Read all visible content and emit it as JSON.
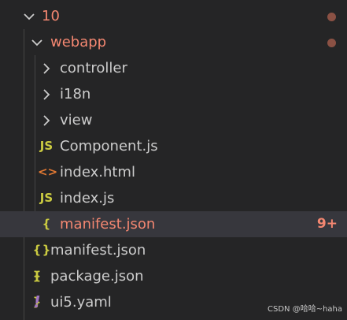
{
  "tree": {
    "root_folder": {
      "label": "10"
    },
    "webapp_folder": {
      "label": "webapp"
    },
    "items": [
      {
        "label": "controller"
      },
      {
        "label": "i18n"
      },
      {
        "label": "view"
      },
      {
        "label": "Component.js",
        "icon_text": "JS"
      },
      {
        "label": "index.html",
        "icon_text": "<>"
      },
      {
        "label": "index.js",
        "icon_text": "JS"
      },
      {
        "label": "manifest.json",
        "icon_text": "{ }",
        "badge": "9+"
      }
    ],
    "root_files": [
      {
        "label": "manifest.json",
        "icon_text": "{ }"
      },
      {
        "label": "package.json",
        "icon_text": "{ }"
      },
      {
        "label": "ui5.yaml",
        "icon_text": "!"
      }
    ]
  },
  "watermark": "CSDN @哈哈~haha",
  "colors": {
    "background": "#252526",
    "selected_row": "#37373d",
    "modified_text": "#f48771",
    "modified_dot": "#8b5144",
    "js_icon": "#cbcb41",
    "html_icon": "#e37933",
    "json_icon": "#cbcb41",
    "yaml_icon": "#a074c4"
  },
  "icons": {
    "expanded": "chevron-down-icon",
    "collapsed": "chevron-right-icon"
  }
}
